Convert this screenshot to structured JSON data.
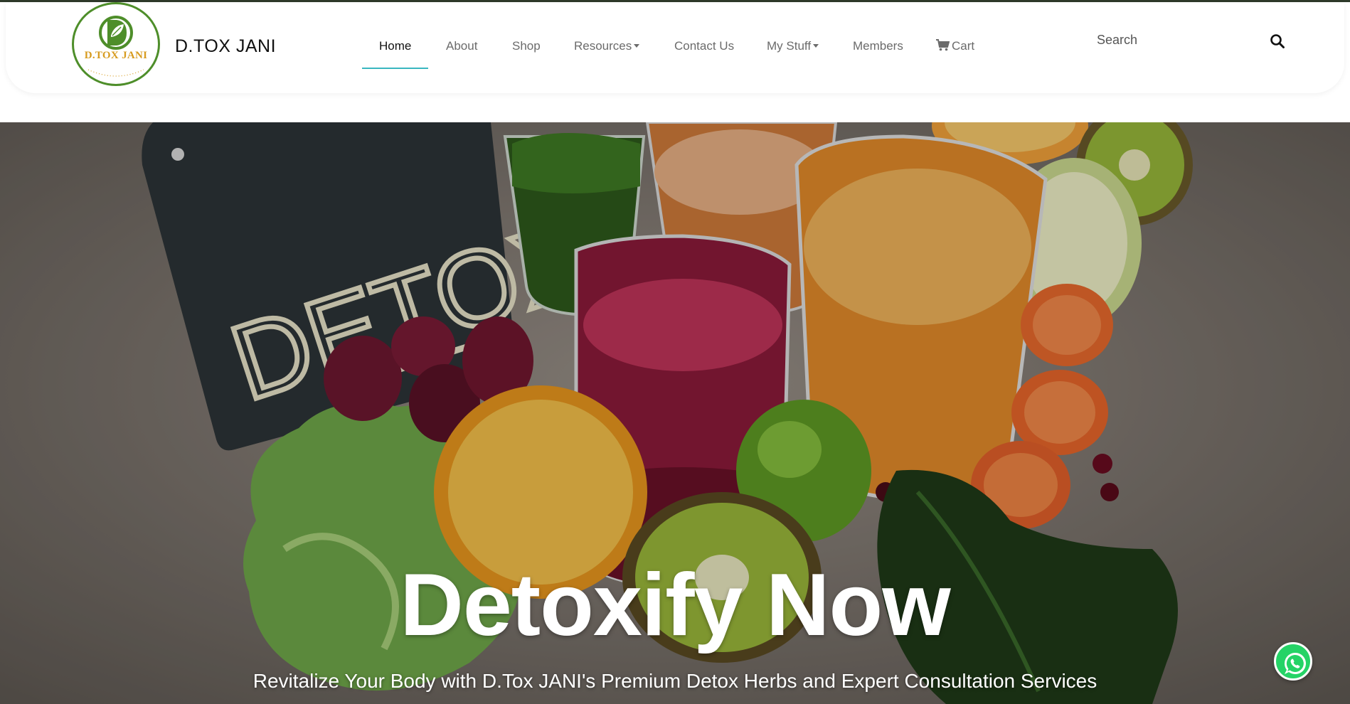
{
  "brand": {
    "logo_text": "D.TOX JANI",
    "name": "D.TOX JANI"
  },
  "nav": {
    "items": [
      {
        "label": "Home",
        "active": true
      },
      {
        "label": "About"
      },
      {
        "label": "Shop"
      },
      {
        "label": "Resources",
        "dropdown": true
      },
      {
        "label": "Contact Us"
      },
      {
        "label": "My Stuff",
        "dropdown": true
      },
      {
        "label": "Members"
      },
      {
        "label": "Cart",
        "icon": "cart-icon"
      }
    ]
  },
  "search": {
    "placeholder": "Search",
    "icon": "search-icon"
  },
  "hero": {
    "chalkboard_text": "DETOX",
    "title": "Detoxify Now",
    "subtitle": "Revitalize Your Body with D.Tox JANI's Premium Detox Herbs and Expert Consultation Services"
  },
  "floating": {
    "whatsapp_icon": "whatsapp-icon"
  },
  "colors": {
    "accent_underline": "#39b7c0",
    "logo_ring": "#4e8e2a",
    "logo_text": "#d79b1f",
    "whatsapp": "#25d366"
  }
}
